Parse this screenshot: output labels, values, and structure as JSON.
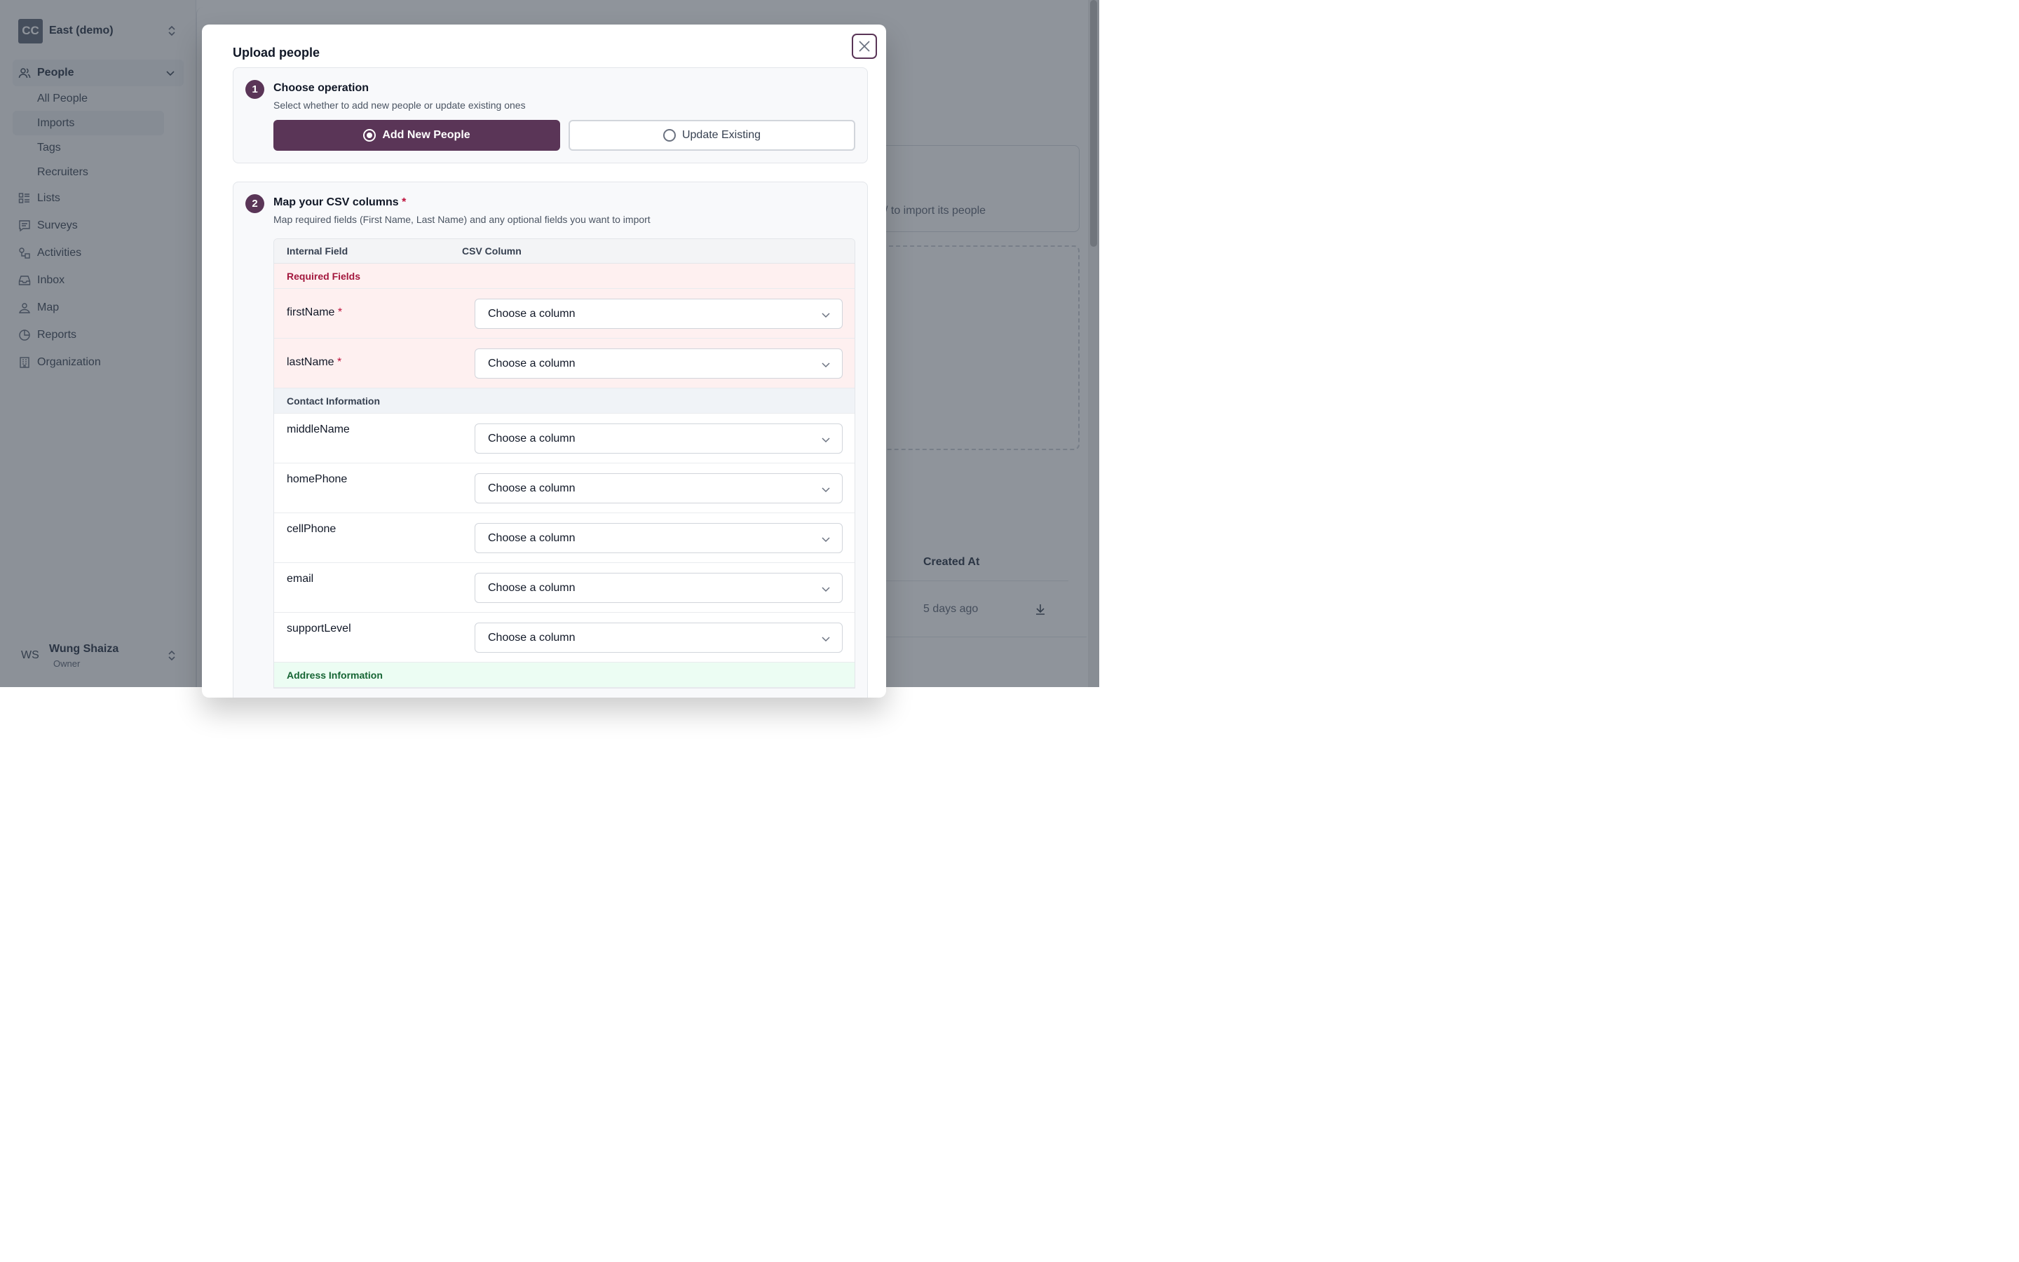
{
  "org": {
    "initials": "CC",
    "name": "East (demo)"
  },
  "nav": {
    "people": "People",
    "people_sub": [
      "All People",
      "Imports",
      "Tags",
      "Recruiters"
    ],
    "items": [
      "Lists",
      "Surveys",
      "Activities",
      "Inbox",
      "Map",
      "Reports",
      "Organization"
    ]
  },
  "user": {
    "initials": "WS",
    "name": "Wung Shaiza",
    "role": "Owner"
  },
  "background": {
    "card_text": "/ to import its people",
    "table_header": "Created At",
    "table_cell": "5 days ago"
  },
  "modal": {
    "title": "Upload people",
    "step1": {
      "number": "1",
      "title": "Choose operation",
      "description": "Select whether to add new people or update existing ones",
      "options": [
        "Add New People",
        "Update Existing"
      ],
      "selected": "Add New People"
    },
    "step2": {
      "number": "2",
      "title": "Map your CSV columns",
      "required_marker": "*",
      "description": "Map required fields (First Name, Last Name) and any optional fields you want to import",
      "columns": [
        "Internal Field",
        "CSV Column"
      ],
      "select_placeholder": "Choose a column",
      "sections": {
        "required": "Required Fields",
        "contact": "Contact Information",
        "address": "Address Information"
      },
      "required_fields": [
        "firstName",
        "lastName"
      ],
      "contact_fields": [
        "middleName",
        "homePhone",
        "cellPhone",
        "email",
        "supportLevel"
      ]
    }
  },
  "colors": {
    "brand": "#5a3557",
    "required": "#be123c"
  }
}
